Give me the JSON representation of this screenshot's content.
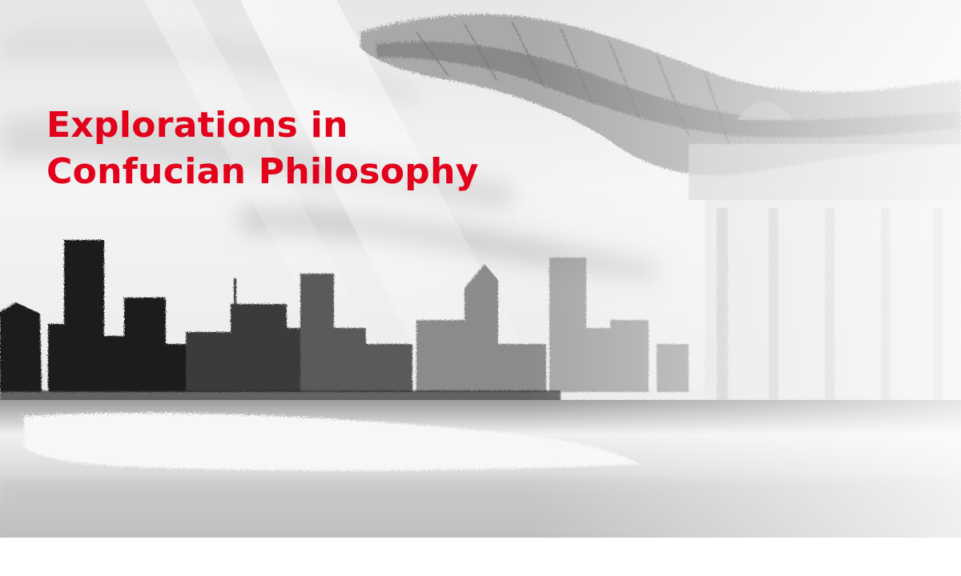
{
  "banner": {
    "title_line_1": "Explorations in",
    "title_line_2": "Confucian Philosophy",
    "accent_color": "#e3001b"
  },
  "illustration": {
    "left_subject": "city-skyline-silhouette",
    "right_subject": "traditional-chinese-pavilion",
    "style": "grayscale brush sketch"
  }
}
